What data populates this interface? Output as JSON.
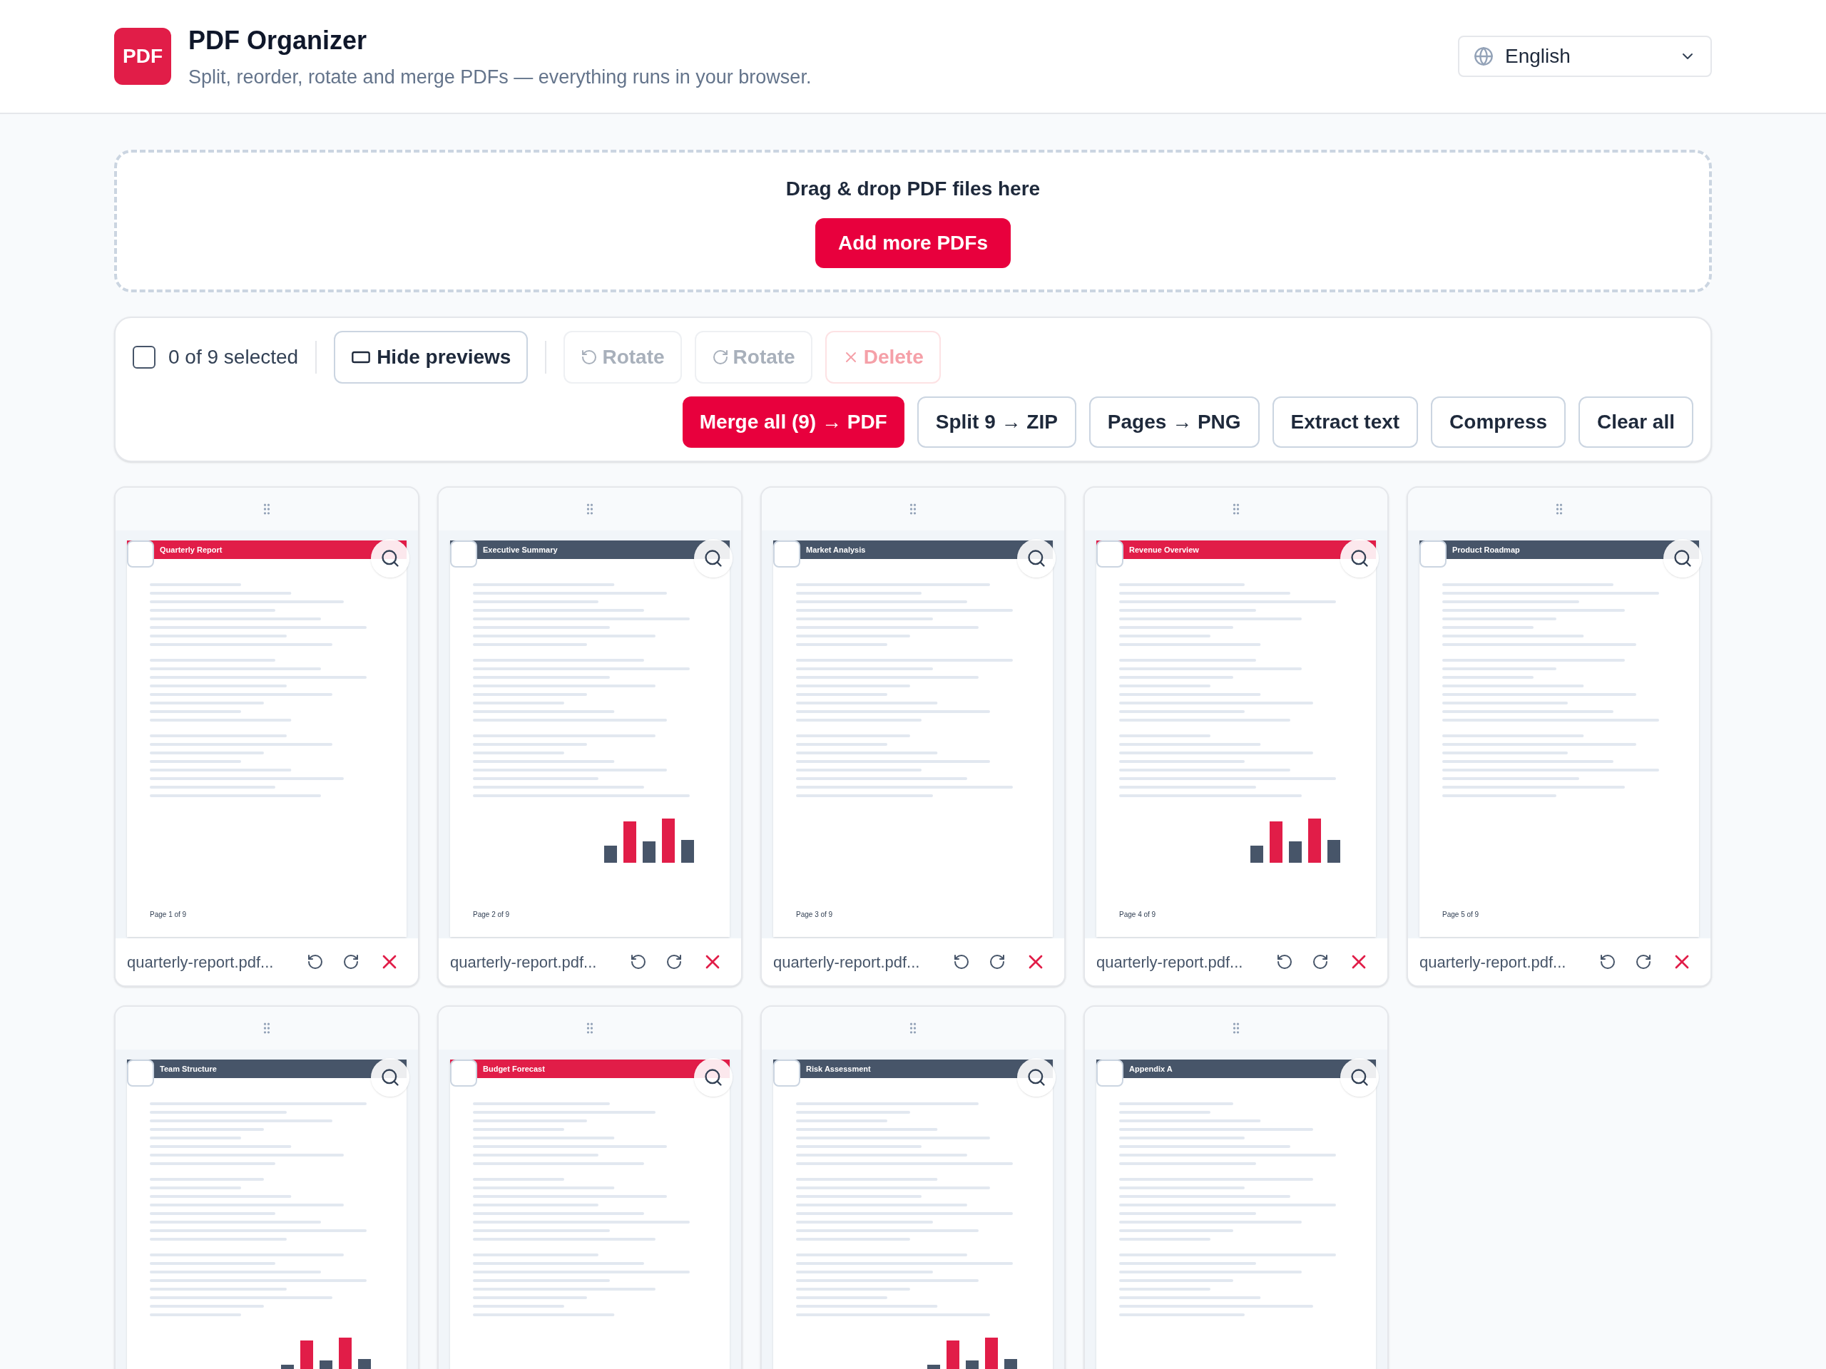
{
  "app": {
    "logo": "PDF",
    "title": "PDF Organizer",
    "subtitle": "Split, reorder, rotate and merge PDFs — everything runs in your browser."
  },
  "language": {
    "value": "English"
  },
  "dropzone": {
    "prompt": "Drag & drop PDF files here",
    "button": "Add more PDFs"
  },
  "toolbar": {
    "selection": {
      "checked": false,
      "label": "0 of 9 selected"
    },
    "hide_previews": "Hide previews",
    "actions": [
      {
        "label": "Rotate",
        "kind": "rotate-left",
        "disabled": true
      },
      {
        "label": "Rotate",
        "kind": "rotate-right",
        "disabled": true
      },
      {
        "label": "Delete",
        "kind": "delete",
        "disabled": true
      }
    ],
    "outputs": [
      {
        "label": "Merge all (9) → PDF",
        "primary": true
      },
      {
        "label": "Split 9 → ZIP",
        "primary": false
      },
      {
        "label": "Pages → PNG",
        "primary": false
      },
      {
        "label": "Extract text",
        "primary": false
      },
      {
        "label": "Compress",
        "primary": false
      },
      {
        "label": "Clear all",
        "primary": false
      }
    ]
  },
  "pages": [
    {
      "title": "Quarterly Report",
      "color": "#e11d48",
      "kind": "text",
      "selected": false,
      "footer": "Page 1 of 9",
      "filename": "quarterly-report.pdf..."
    },
    {
      "title": "Executive Summary",
      "color": "#475569",
      "kind": "chart",
      "selected": false,
      "footer": "Page 2 of 9",
      "filename": "quarterly-report.pdf..."
    },
    {
      "title": "Market Analysis",
      "color": "#475569",
      "kind": "text",
      "selected": false,
      "footer": "Page 3 of 9",
      "filename": "quarterly-report.pdf..."
    },
    {
      "title": "Revenue Overview",
      "color": "#e11d48",
      "kind": "chart",
      "selected": false,
      "footer": "Page 4 of 9",
      "filename": "quarterly-report.pdf..."
    },
    {
      "title": "Product Roadmap",
      "color": "#475569",
      "kind": "text",
      "selected": false,
      "footer": "Page 5 of 9",
      "filename": "quarterly-report.pdf..."
    },
    {
      "title": "Team Structure",
      "color": "#475569",
      "kind": "chart",
      "selected": false
    },
    {
      "title": "Budget Forecast",
      "color": "#e11d48",
      "kind": "text",
      "selected": false
    },
    {
      "title": "Risk Assessment",
      "color": "#475569",
      "kind": "chart",
      "selected": false
    },
    {
      "title": "Appendix A",
      "color": "#475569",
      "kind": "text",
      "selected": false
    }
  ]
}
